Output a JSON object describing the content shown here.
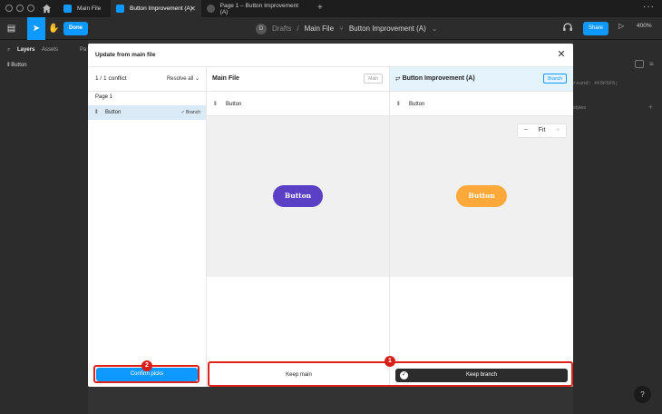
{
  "tabs": [
    {
      "label": "Main File",
      "color": "#0d99ff"
    },
    {
      "label": "Button Improvement (A)",
      "color": "#0d99ff",
      "active": true
    },
    {
      "label": "Page 1 – Button Improvement (A)",
      "color": "#666666"
    }
  ],
  "toolbar": {
    "done_label": "Done",
    "breadcrumb": {
      "avatar": "D",
      "drafts": "Drafts",
      "sep": "/",
      "file": "Main File",
      "branch": "Button Improvement (A)"
    },
    "share_label": "Share",
    "zoom_label": "400%"
  },
  "left_panel": {
    "layers_tab": "Layers",
    "assets_tab": "Assets",
    "pages_tab": "Pa",
    "layer_item": "Button"
  },
  "right_panel": {
    "background_text": "round: #F5F5F5;",
    "styles_text": "styles"
  },
  "modal": {
    "title": "Update from main file",
    "sidebar": {
      "conflict_count": "1 / 1 conflict",
      "resolve_all": "Resolve all",
      "page_label": "Page 1",
      "item_label": "Button",
      "item_status": "Branch"
    },
    "main_col": {
      "title": "Main File",
      "tag": "Main",
      "row_label": "Button",
      "preview_button": "Button",
      "preview_color": "#5b3fc4"
    },
    "branch_col": {
      "title": "Button Improvement (A)",
      "tag": "Branch",
      "row_label": "Button",
      "preview_button": "Button",
      "preview_color": "#ffa93b"
    },
    "zoom_fit": "Fit",
    "confirm_label": "Confirm picks",
    "keep_main_label": "Keep main",
    "keep_branch_label": "Keep branch",
    "badges": [
      "1",
      "2"
    ]
  },
  "accent_color": "#0d99ff",
  "highlight_color": "#e0201a"
}
